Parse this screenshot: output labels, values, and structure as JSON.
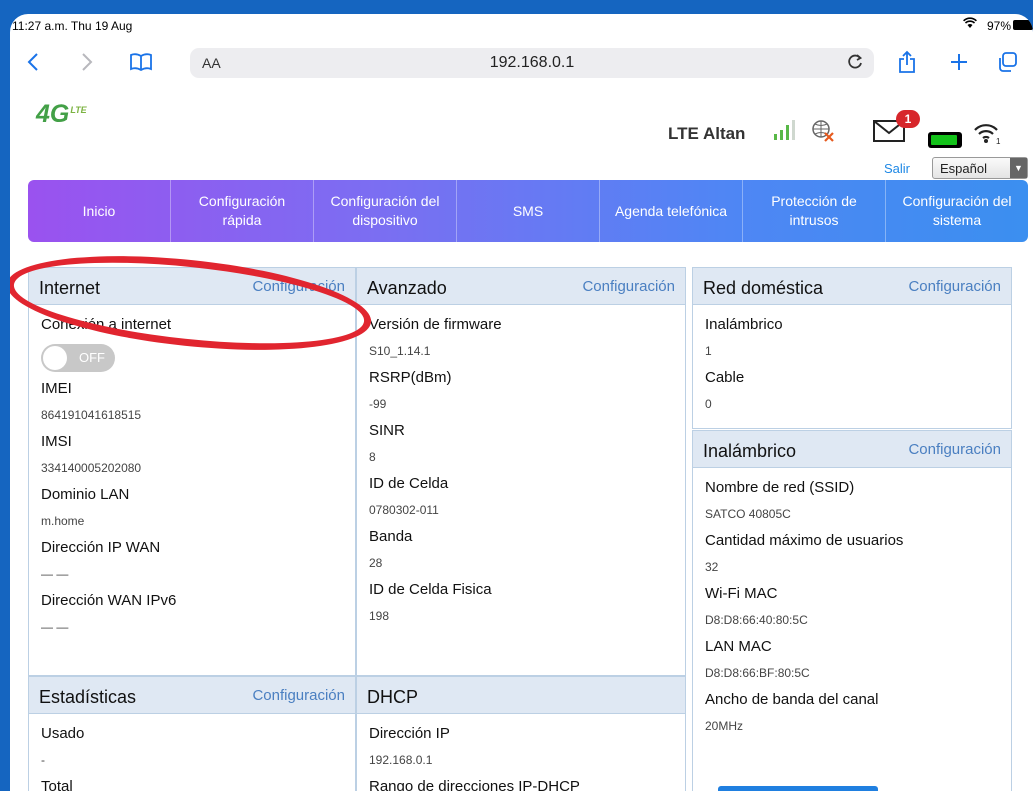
{
  "status_bar": {
    "time": "11:27 a.m.  Thu 19 Aug",
    "battery": "97%"
  },
  "browser": {
    "text_size_label": "AA",
    "url": "192.168.0.1"
  },
  "header": {
    "logo_text": "4G",
    "logo_sup": "LTE",
    "network_name": "LTE Altan",
    "unread_count": "1",
    "logout_label": "Salir",
    "language": "Español"
  },
  "menu": {
    "items": [
      {
        "label": "Inicio"
      },
      {
        "label": "Configuración\nrápida"
      },
      {
        "label": "Configuración del\ndispositivo"
      },
      {
        "label": "SMS"
      },
      {
        "label": "Agenda telefónica"
      },
      {
        "label": "Protección de\nintrusos"
      },
      {
        "label": "Configuración del\nsistema"
      }
    ]
  },
  "internet": {
    "title": "Internet",
    "config_link": "Configuración",
    "connection_label": "Conexión a internet",
    "toggle_state": "OFF",
    "fields": [
      {
        "label": "IMEI",
        "value": "864191041618515"
      },
      {
        "label": "IMSI",
        "value": "334140005202080"
      },
      {
        "label": "Dominio LAN",
        "value": "m.home"
      },
      {
        "label": "Dirección IP WAN",
        "value": "— —"
      },
      {
        "label": "Dirección WAN IPv6",
        "value": "— —"
      }
    ]
  },
  "stats": {
    "title": "Estadísticas",
    "config_link": "Configuración",
    "used_label": "Usado",
    "used_value": "-",
    "total_label": "Total"
  },
  "advanced": {
    "title": "Avanzado",
    "config_link": "Configuración",
    "fields": [
      {
        "label": "Versión de firmware",
        "value": "S10_1.14.1"
      },
      {
        "label": "RSRP(dBm)",
        "value": "-99"
      },
      {
        "label": "SINR",
        "value": "8"
      },
      {
        "label": "ID de Celda",
        "value": "0780302-011"
      },
      {
        "label": "Banda",
        "value": "28"
      },
      {
        "label": "ID de Celda Fisica",
        "value": "198"
      }
    ]
  },
  "dhcp": {
    "title": "DHCP",
    "ip_label": "Dirección IP",
    "ip_value": "192.168.0.1",
    "range_label": "Rango de direcciones IP-DHCP"
  },
  "home_network": {
    "title": "Red doméstica",
    "config_link": "Configuración",
    "fields": [
      {
        "label": "Inalámbrico",
        "value": "1"
      },
      {
        "label": "Cable",
        "value": "0"
      }
    ]
  },
  "wireless": {
    "title": "Inalámbrico",
    "config_link": "Configuración",
    "fields": [
      {
        "label": "Nombre de red (SSID)",
        "value": "SATCO 40805C"
      },
      {
        "label": "Cantidad máximo de usuarios",
        "value": "32"
      },
      {
        "label": "Wi-Fi MAC",
        "value": "D8:D8:66:40:80:5C"
      },
      {
        "label": "LAN MAC",
        "value": "D8:D8:66:BF:80:5C"
      },
      {
        "label": "Ancho de banda del canal",
        "value": "20MHz"
      }
    ]
  },
  "colors": {
    "accent": "#1e88e5",
    "header_bg": "#dfe8f3",
    "highlight": "#e1252f",
    "menu_start": "#9a52ef",
    "menu_end": "#3b8ff0"
  },
  "icons": [
    "back-icon",
    "forward-icon",
    "bookmarks-icon",
    "reload-icon",
    "share-icon",
    "new-tab-icon",
    "tabs-icon",
    "signal-icon",
    "globe-disabled-icon",
    "mail-icon",
    "battery-icon",
    "wifi-icon"
  ]
}
